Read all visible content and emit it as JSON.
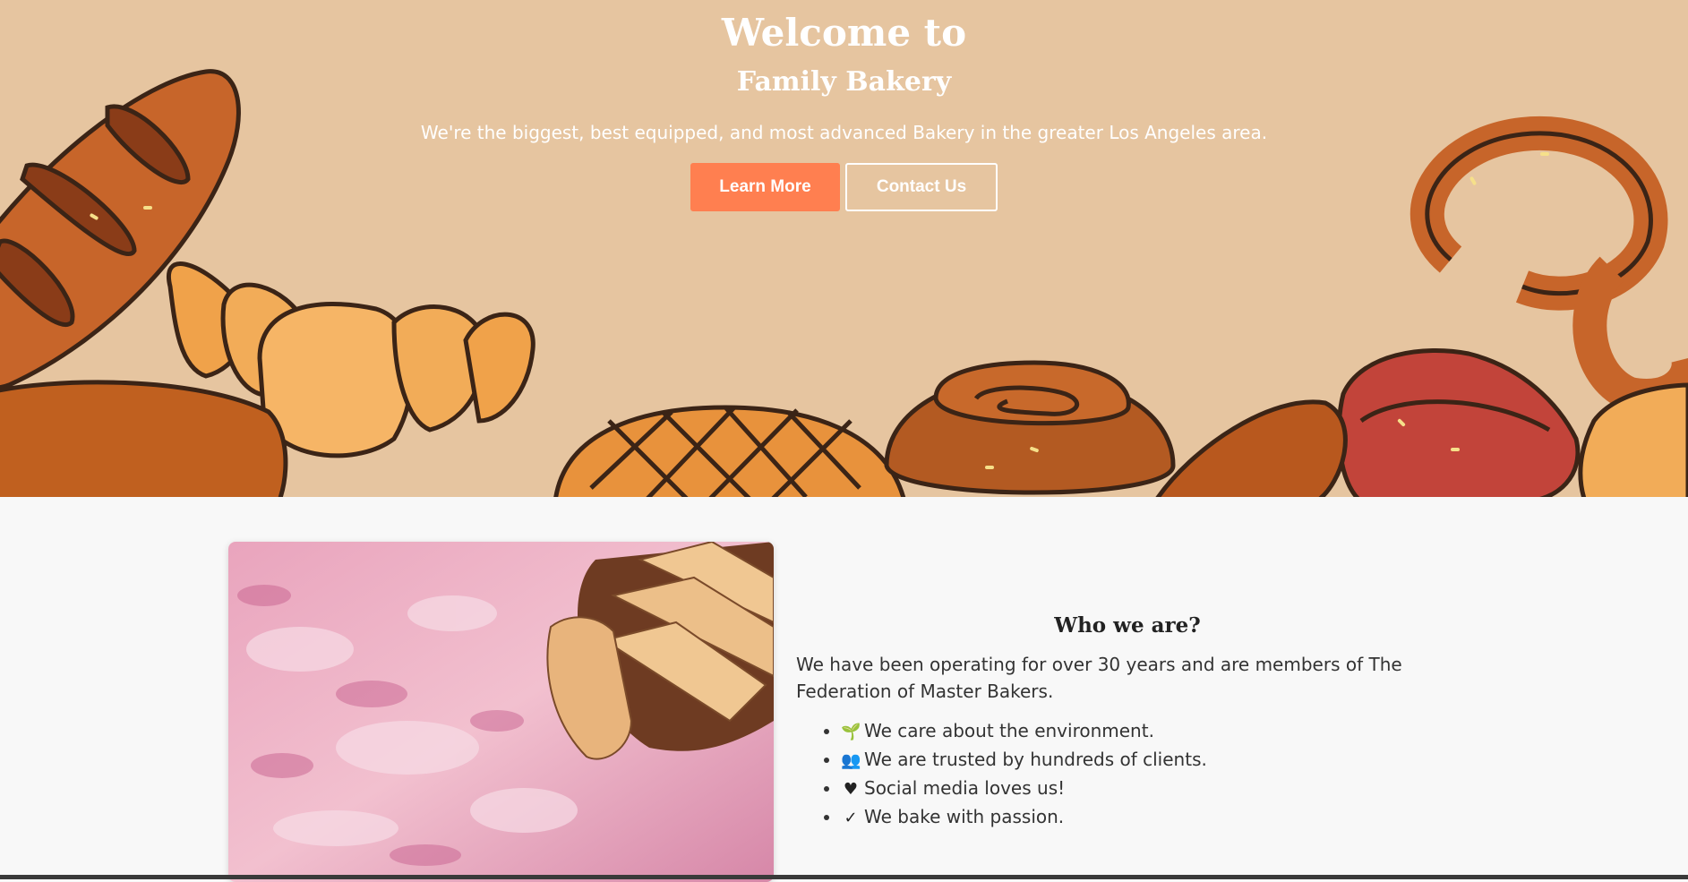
{
  "hero": {
    "title": "Welcome to",
    "subtitle": "Family Bakery",
    "tagline": "We're the biggest, best equipped, and most advanced Bakery in the greater Los Angeles area.",
    "primary_button": "Learn More",
    "secondary_button": "Contact Us",
    "background_color": "#e6c5a0",
    "accent_color": "#ff7f50"
  },
  "about": {
    "heading": "Who we are?",
    "paragraph": "We have been operating for over 30 years and are members of The Federation of Master Bakers.",
    "features": [
      {
        "icon": "seedling-icon",
        "glyph": "🌱",
        "text": "We care about the environment."
      },
      {
        "icon": "users-icon",
        "glyph": "👥",
        "text": "We are trusted by hundreds of clients."
      },
      {
        "icon": "heart-icon",
        "glyph": "♥",
        "text": "Social media loves us!"
      },
      {
        "icon": "check-icon",
        "glyph": "✓",
        "text": "We bake with passion."
      }
    ]
  }
}
